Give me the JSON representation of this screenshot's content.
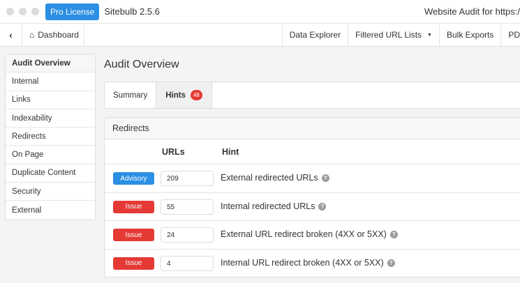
{
  "titlebar": {
    "license": "Pro License",
    "app": "Sitebulb 2.5.6",
    "audit_title": "Website Audit for https:/"
  },
  "nav": {
    "back": "‹",
    "dashboard": "Dashboard",
    "items": [
      "Data Explorer",
      "Filtered URL Lists",
      "Bulk Exports",
      "PD"
    ]
  },
  "sidebar": {
    "items": [
      "Audit Overview",
      "Internal",
      "Links",
      "Indexability",
      "Redirects",
      "On Page",
      "Duplicate Content",
      "Security",
      "External"
    ]
  },
  "main": {
    "title": "Audit Overview",
    "tabs": [
      {
        "label": "Summary"
      },
      {
        "label": "Hints",
        "badge": "48"
      }
    ],
    "panel": {
      "title": "Redirects",
      "columns": [
        "URLs",
        "Hint"
      ],
      "rows": [
        {
          "type": "Advisory",
          "color": "#2b8fe3",
          "count": "209",
          "hint": "External redirected URLs"
        },
        {
          "type": "Issue",
          "color": "#e53935",
          "count": "55",
          "hint": "Internal redirected URLs"
        },
        {
          "type": "Issue",
          "color": "#e53935",
          "count": "24",
          "hint": "External URL redirect broken (4XX or 5XX)"
        },
        {
          "type": "Issue",
          "color": "#e53935",
          "count": "4",
          "hint": "Internal URL redirect broken (4XX or 5XX)"
        }
      ]
    }
  }
}
